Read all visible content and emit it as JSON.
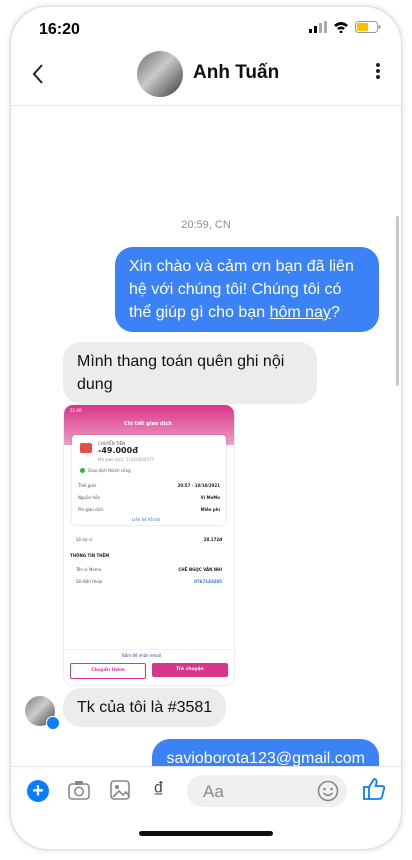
{
  "status_bar": {
    "time": "16:20"
  },
  "header": {
    "contact_name": "Anh Tuấn"
  },
  "chat": {
    "date_label": "20:59, CN",
    "outgoing_1": {
      "text_before": "Xin chào và cảm ơn bạn đã liên hệ với chúng tôi! Chúng tôi có thể giúp gì cho bạn ",
      "link": "hôm nay",
      "text_after": "?"
    },
    "incoming_1": "Mình thang toán quên ghi nội dung",
    "receipt": {
      "title": "Chi tiết giao dịch",
      "status_time": "21:00",
      "type_label": "CHUYỂN TIỀN",
      "amount": "-49.000đ",
      "tx_code": "Mã giao dịch: 11810934577",
      "success": "Giao dịch thành công",
      "rows": [
        {
          "label": "Thời gian",
          "value": "20:57 - 10/10/2021"
        },
        {
          "label": "Nguồn tiền",
          "value": "Ví MoMo"
        },
        {
          "label": "Phí giao dịch",
          "value": "Miễn phí"
        }
      ],
      "support": "Liên hệ hỗ trợ",
      "balance_label": "Số dư ví",
      "balance_value": "28.172đ",
      "more_info": "THÔNG TIN THÊM",
      "extra_rows": [
        {
          "label": "Tên ví Momo",
          "value": "CHẾ NGỌC VÂN NHI"
        },
        {
          "label": "Số điện thoại",
          "value": "0767143285"
        }
      ],
      "email_note": "Bấm để nhận email",
      "btn_transfer": "Chuyển thêm",
      "btn_chat": "Trò chuyện"
    },
    "incoming_2": "Tk của tôi là #3581",
    "outgoing_2": "savioborota123@gmail.com"
  },
  "composer": {
    "placeholder": "Aa"
  },
  "colors": {
    "messenger_blue": "#3b82f6",
    "momo_pink": "#d9358a"
  }
}
